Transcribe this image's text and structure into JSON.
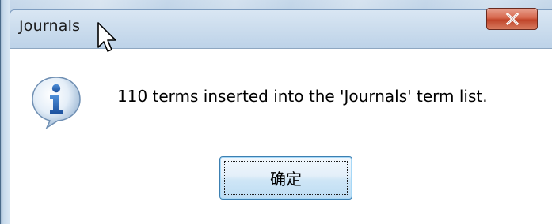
{
  "window": {
    "title": "Journals",
    "close_icon": "close-icon"
  },
  "dialog": {
    "icon": "information-icon",
    "message": "110 terms inserted into the 'Journals' term list.",
    "ok_label": "确定"
  },
  "colors": {
    "close_button": "#c7472b",
    "ok_border": "#3c7fb1",
    "info_icon_blue": "#2b6cc4"
  }
}
